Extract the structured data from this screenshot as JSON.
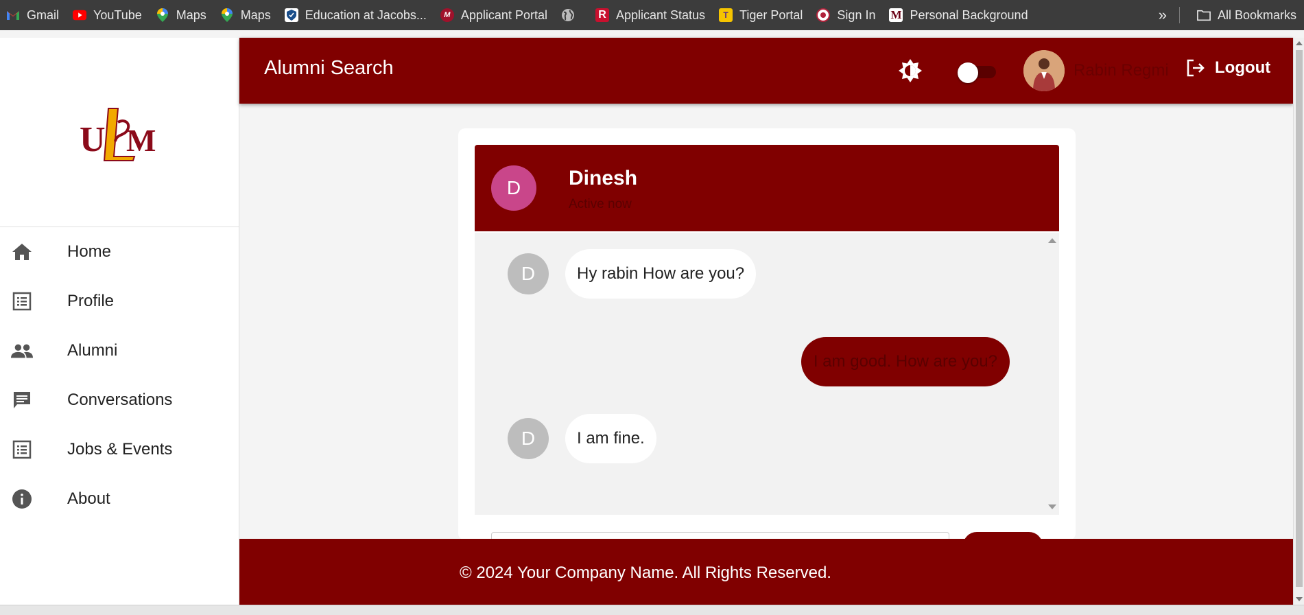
{
  "bookmarks": {
    "items": [
      {
        "label": "Gmail",
        "icon": "gmail-icon"
      },
      {
        "label": "YouTube",
        "icon": "youtube-icon"
      },
      {
        "label": "Maps",
        "icon": "maps-pin-icon"
      },
      {
        "label": "Maps",
        "icon": "maps-pin-icon"
      },
      {
        "label": "Education at Jacobs...",
        "icon": "shield-icon"
      },
      {
        "label": "Applicant Portal",
        "icon": "applicant-portal-icon"
      },
      {
        "label": "",
        "icon": "globe-icon"
      },
      {
        "label": "Applicant Status",
        "icon": "r-logo-icon"
      },
      {
        "label": "Tiger Portal",
        "icon": "tiger-icon"
      },
      {
        "label": "Sign In",
        "icon": "seal-icon"
      },
      {
        "label": "Personal Background",
        "icon": "m-logo-icon"
      }
    ],
    "more_icon": "double-chevron-icon",
    "all_bookmarks_label": "All Bookmarks"
  },
  "header": {
    "title": "Alumni Search",
    "user_name": "Rabin Regmi",
    "logout_label": "Logout",
    "theme_icon": "brightness-icon",
    "toggle_on": false
  },
  "sidebar": {
    "logo_text": "ULM",
    "items": [
      {
        "label": "Home",
        "icon": "home-icon"
      },
      {
        "label": "Profile",
        "icon": "list-icon"
      },
      {
        "label": "Alumni",
        "icon": "people-icon"
      },
      {
        "label": "Conversations",
        "icon": "chat-icon"
      },
      {
        "label": "Jobs & Events",
        "icon": "list-icon"
      },
      {
        "label": "About",
        "icon": "info-icon"
      }
    ]
  },
  "chat": {
    "contact_initial": "D",
    "contact_name": "Dinesh",
    "status": "Active now",
    "messages": [
      {
        "from": "contact",
        "initial": "D",
        "text": "Hy rabin How are you?"
      },
      {
        "from": "me",
        "text": "I am good. How are you?"
      },
      {
        "from": "contact",
        "initial": "D",
        "text": "I am fine."
      }
    ]
  },
  "footer": {
    "text": "© 2024 Your Company Name. All Rights Reserved."
  },
  "colors": {
    "brand": "#800000",
    "contact_avatar": "#c9468a",
    "message_avatar": "#bdbdbd"
  }
}
